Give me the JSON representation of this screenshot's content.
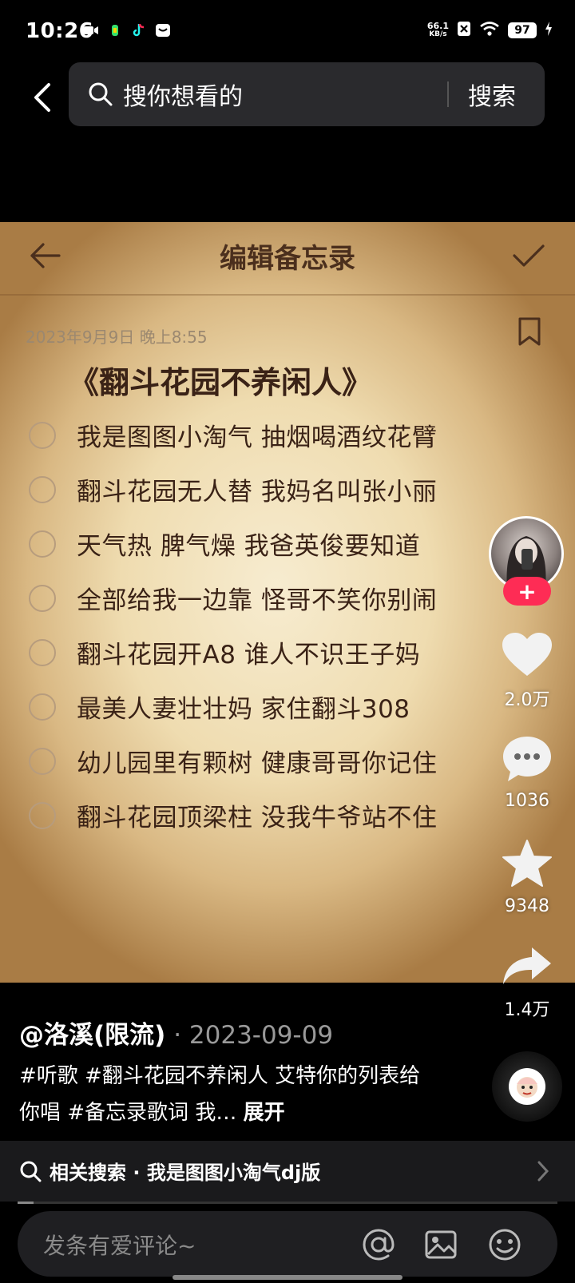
{
  "status_bar": {
    "time": "10:26",
    "net_speed_value": "66.1",
    "net_speed_unit": "KB/s",
    "battery": "97"
  },
  "search": {
    "placeholder": "搜你想看的",
    "button": "搜索"
  },
  "memo": {
    "title": "编辑备忘录",
    "date": "2023年9月9日 晚上8:55",
    "heading": "《翻斗花园不养闲人》",
    "items": [
      "我是图图小淘气 抽烟喝酒纹花臂",
      "翻斗花园无人替 我妈名叫张小丽",
      "天气热 脾气燥 我爸英俊要知道",
      "全部给我一边靠 怪哥不笑你别闹",
      "翻斗花园开A8 谁人不识王子妈",
      "最美人妻壮壮妈 家住翻斗308",
      "幼儿园里有颗树 健康哥哥你记住",
      "翻斗花园顶梁柱 没我牛爷站不住"
    ]
  },
  "rail": {
    "follow_symbol": "+",
    "likes": "2.0万",
    "comments": "1036",
    "favorites": "9348",
    "shares": "1.4万"
  },
  "post": {
    "author": "@洛溪(限流)",
    "date": "· 2023-09-09",
    "desc": "#听歌 #翻斗花园不养闲人 艾特你的列表给你唱 #备忘录歌词 我…",
    "expand": "展开"
  },
  "related": {
    "label": "相关搜索 · 我是图图小淘气dj版"
  },
  "progress": 0.03,
  "comment": {
    "placeholder": "发条有爱评论~"
  },
  "colors": {
    "accent": "#fe2c55",
    "background": "#000000",
    "memo_text": "#3a2216"
  }
}
